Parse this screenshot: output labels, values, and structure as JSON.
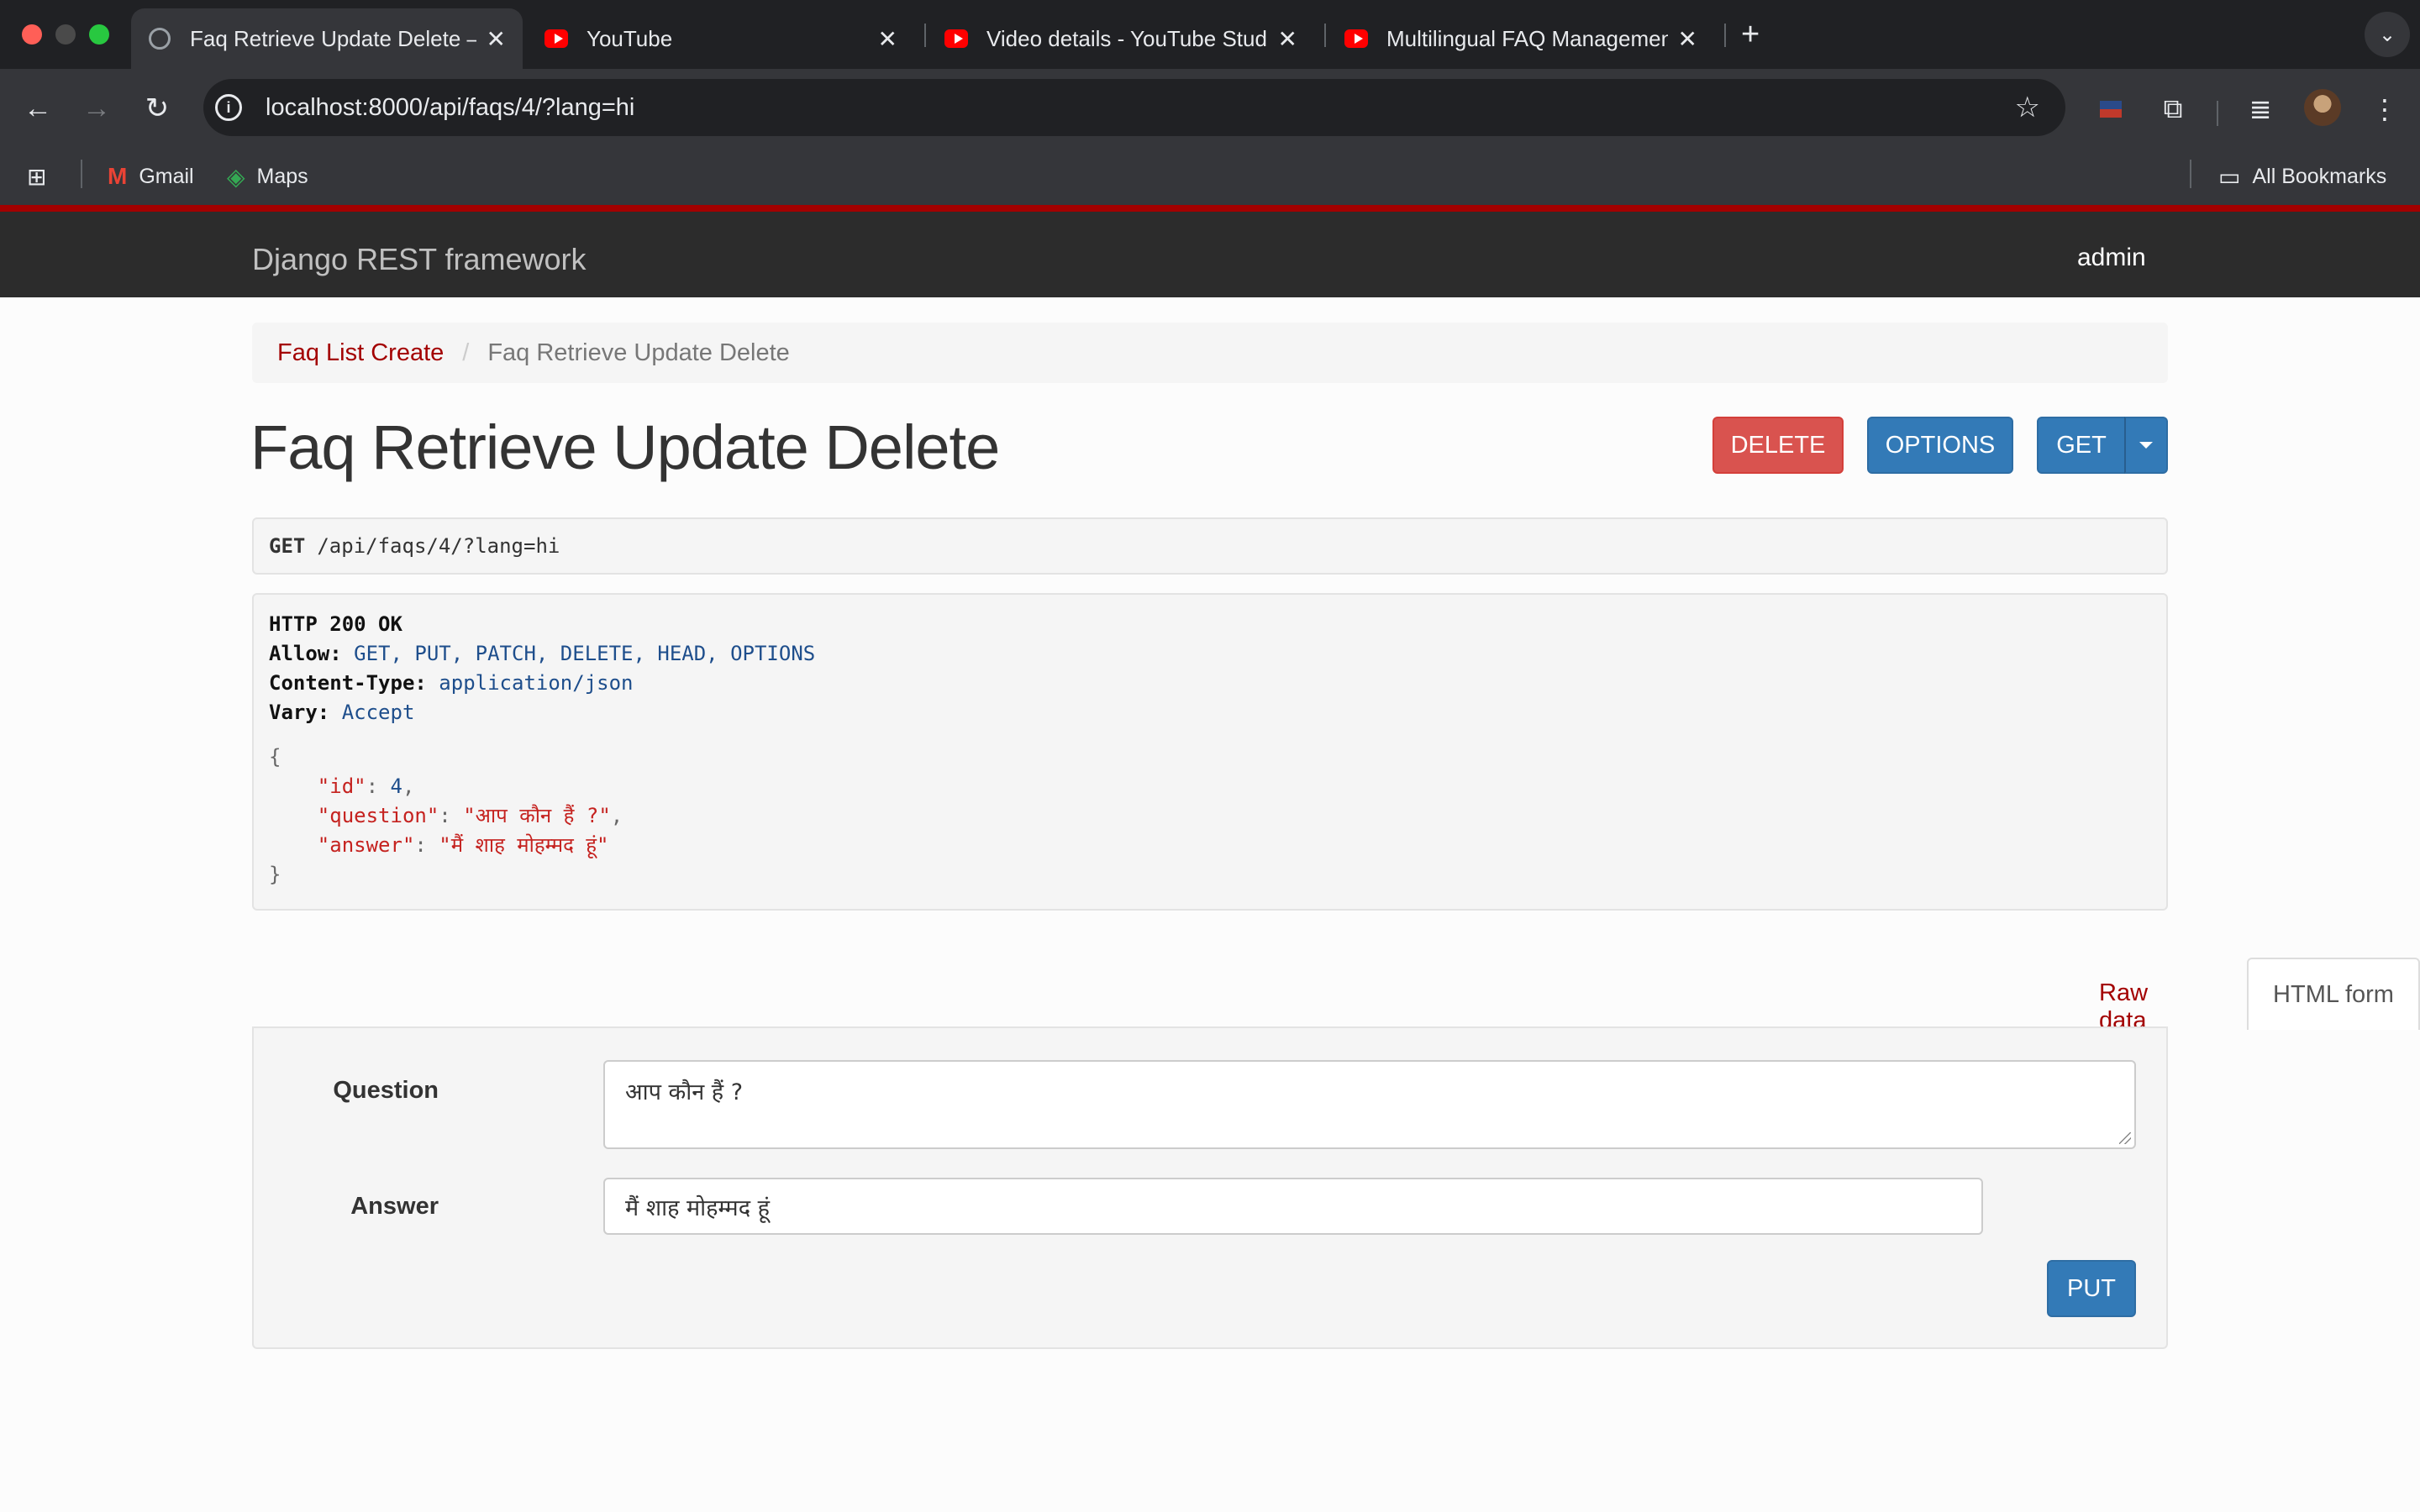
{
  "browser": {
    "tabs": [
      {
        "title": "Faq Retrieve Update Delete – Dj",
        "favicon": "globe-icon",
        "active": true
      },
      {
        "title": "YouTube",
        "favicon": "youtube-icon",
        "active": false
      },
      {
        "title": "Video details - YouTube Studio",
        "favicon": "youtube-icon",
        "active": false
      },
      {
        "title": "Multilingual FAQ Management",
        "favicon": "youtube-icon",
        "active": false
      }
    ],
    "new_tab_label": "+",
    "url": "localhost:8000/api/faqs/4/?lang=hi",
    "bookmarks": [
      {
        "label": "Gmail",
        "icon": "gmail-icon"
      },
      {
        "label": "Maps",
        "icon": "maps-icon"
      }
    ],
    "all_bookmarks_label": "All Bookmarks"
  },
  "navbar": {
    "brand": "Django REST framework",
    "user": "admin",
    "accent_color": "#a30000"
  },
  "breadcrumb": {
    "parent": "Faq List Create",
    "current": "Faq Retrieve Update Delete"
  },
  "page": {
    "title": "Faq Retrieve Update Delete",
    "buttons": {
      "delete": "DELETE",
      "options": "OPTIONS",
      "get": "GET"
    }
  },
  "request": {
    "method": "GET",
    "path": "/api/faqs/4/?lang=hi"
  },
  "response": {
    "status": "HTTP 200 OK",
    "headers": [
      {
        "key": "Allow:",
        "value": "GET, PUT, PATCH, DELETE, HEAD, OPTIONS"
      },
      {
        "key": "Content-Type:",
        "value": "application/json"
      },
      {
        "key": "Vary:",
        "value": "Accept"
      }
    ],
    "body": {
      "open": "{",
      "close": "}",
      "fields": [
        {
          "key": "\"id\"",
          "value": "4",
          "type": "num",
          "trail": ","
        },
        {
          "key": "\"question\"",
          "value": "\"आप कौन हैं ?\"",
          "type": "str",
          "trail": ","
        },
        {
          "key": "\"answer\"",
          "value": "\"मैं शाह मोहम्मद हूं\"",
          "type": "str",
          "trail": ""
        }
      ]
    }
  },
  "form": {
    "tabs": {
      "raw": "Raw data",
      "html": "HTML form"
    },
    "question_label": "Question",
    "question_value": "आप कौन हैं ?",
    "answer_label": "Answer",
    "answer_value": "मैं शाह मोहम्मद हूं",
    "submit": "PUT"
  }
}
